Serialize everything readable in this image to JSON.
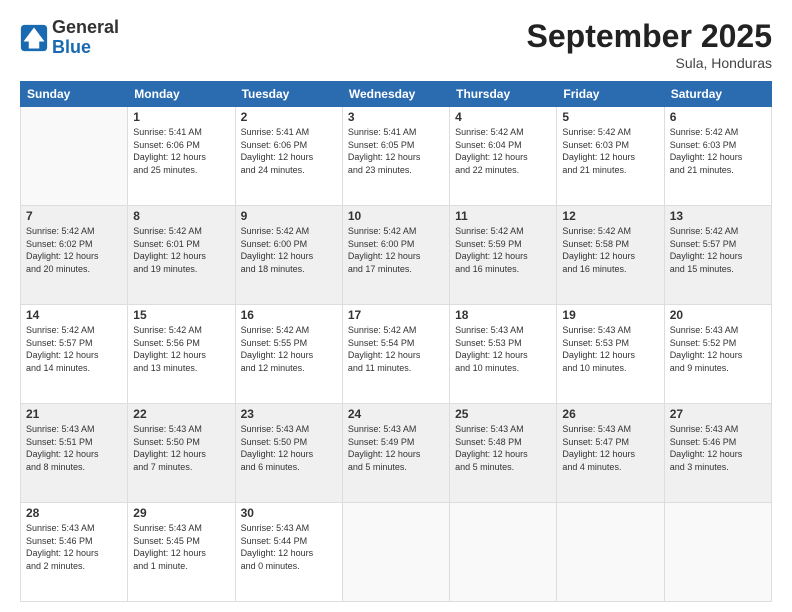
{
  "header": {
    "logo_general": "General",
    "logo_blue": "Blue",
    "month_title": "September 2025",
    "subtitle": "Sula, Honduras"
  },
  "columns": [
    "Sunday",
    "Monday",
    "Tuesday",
    "Wednesday",
    "Thursday",
    "Friday",
    "Saturday"
  ],
  "weeks": [
    {
      "shaded": false,
      "days": [
        {
          "num": "",
          "info": ""
        },
        {
          "num": "1",
          "info": "Sunrise: 5:41 AM\nSunset: 6:06 PM\nDaylight: 12 hours\nand 25 minutes."
        },
        {
          "num": "2",
          "info": "Sunrise: 5:41 AM\nSunset: 6:06 PM\nDaylight: 12 hours\nand 24 minutes."
        },
        {
          "num": "3",
          "info": "Sunrise: 5:41 AM\nSunset: 6:05 PM\nDaylight: 12 hours\nand 23 minutes."
        },
        {
          "num": "4",
          "info": "Sunrise: 5:42 AM\nSunset: 6:04 PM\nDaylight: 12 hours\nand 22 minutes."
        },
        {
          "num": "5",
          "info": "Sunrise: 5:42 AM\nSunset: 6:03 PM\nDaylight: 12 hours\nand 21 minutes."
        },
        {
          "num": "6",
          "info": "Sunrise: 5:42 AM\nSunset: 6:03 PM\nDaylight: 12 hours\nand 21 minutes."
        }
      ]
    },
    {
      "shaded": true,
      "days": [
        {
          "num": "7",
          "info": "Sunrise: 5:42 AM\nSunset: 6:02 PM\nDaylight: 12 hours\nand 20 minutes."
        },
        {
          "num": "8",
          "info": "Sunrise: 5:42 AM\nSunset: 6:01 PM\nDaylight: 12 hours\nand 19 minutes."
        },
        {
          "num": "9",
          "info": "Sunrise: 5:42 AM\nSunset: 6:00 PM\nDaylight: 12 hours\nand 18 minutes."
        },
        {
          "num": "10",
          "info": "Sunrise: 5:42 AM\nSunset: 6:00 PM\nDaylight: 12 hours\nand 17 minutes."
        },
        {
          "num": "11",
          "info": "Sunrise: 5:42 AM\nSunset: 5:59 PM\nDaylight: 12 hours\nand 16 minutes."
        },
        {
          "num": "12",
          "info": "Sunrise: 5:42 AM\nSunset: 5:58 PM\nDaylight: 12 hours\nand 16 minutes."
        },
        {
          "num": "13",
          "info": "Sunrise: 5:42 AM\nSunset: 5:57 PM\nDaylight: 12 hours\nand 15 minutes."
        }
      ]
    },
    {
      "shaded": false,
      "days": [
        {
          "num": "14",
          "info": "Sunrise: 5:42 AM\nSunset: 5:57 PM\nDaylight: 12 hours\nand 14 minutes."
        },
        {
          "num": "15",
          "info": "Sunrise: 5:42 AM\nSunset: 5:56 PM\nDaylight: 12 hours\nand 13 minutes."
        },
        {
          "num": "16",
          "info": "Sunrise: 5:42 AM\nSunset: 5:55 PM\nDaylight: 12 hours\nand 12 minutes."
        },
        {
          "num": "17",
          "info": "Sunrise: 5:42 AM\nSunset: 5:54 PM\nDaylight: 12 hours\nand 11 minutes."
        },
        {
          "num": "18",
          "info": "Sunrise: 5:43 AM\nSunset: 5:53 PM\nDaylight: 12 hours\nand 10 minutes."
        },
        {
          "num": "19",
          "info": "Sunrise: 5:43 AM\nSunset: 5:53 PM\nDaylight: 12 hours\nand 10 minutes."
        },
        {
          "num": "20",
          "info": "Sunrise: 5:43 AM\nSunset: 5:52 PM\nDaylight: 12 hours\nand 9 minutes."
        }
      ]
    },
    {
      "shaded": true,
      "days": [
        {
          "num": "21",
          "info": "Sunrise: 5:43 AM\nSunset: 5:51 PM\nDaylight: 12 hours\nand 8 minutes."
        },
        {
          "num": "22",
          "info": "Sunrise: 5:43 AM\nSunset: 5:50 PM\nDaylight: 12 hours\nand 7 minutes."
        },
        {
          "num": "23",
          "info": "Sunrise: 5:43 AM\nSunset: 5:50 PM\nDaylight: 12 hours\nand 6 minutes."
        },
        {
          "num": "24",
          "info": "Sunrise: 5:43 AM\nSunset: 5:49 PM\nDaylight: 12 hours\nand 5 minutes."
        },
        {
          "num": "25",
          "info": "Sunrise: 5:43 AM\nSunset: 5:48 PM\nDaylight: 12 hours\nand 5 minutes."
        },
        {
          "num": "26",
          "info": "Sunrise: 5:43 AM\nSunset: 5:47 PM\nDaylight: 12 hours\nand 4 minutes."
        },
        {
          "num": "27",
          "info": "Sunrise: 5:43 AM\nSunset: 5:46 PM\nDaylight: 12 hours\nand 3 minutes."
        }
      ]
    },
    {
      "shaded": false,
      "days": [
        {
          "num": "28",
          "info": "Sunrise: 5:43 AM\nSunset: 5:46 PM\nDaylight: 12 hours\nand 2 minutes."
        },
        {
          "num": "29",
          "info": "Sunrise: 5:43 AM\nSunset: 5:45 PM\nDaylight: 12 hours\nand 1 minute."
        },
        {
          "num": "30",
          "info": "Sunrise: 5:43 AM\nSunset: 5:44 PM\nDaylight: 12 hours\nand 0 minutes."
        },
        {
          "num": "",
          "info": ""
        },
        {
          "num": "",
          "info": ""
        },
        {
          "num": "",
          "info": ""
        },
        {
          "num": "",
          "info": ""
        }
      ]
    }
  ]
}
